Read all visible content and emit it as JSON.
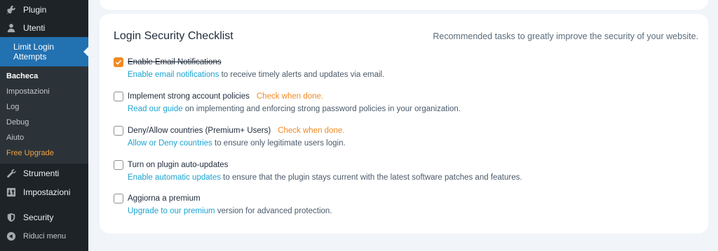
{
  "sidebar": {
    "items_top": [
      {
        "label": "Plugin",
        "icon": "plugin-icon"
      },
      {
        "label": "Utenti",
        "icon": "users-icon"
      }
    ],
    "active": {
      "label": "Limit Login Attempts",
      "icon": "fingerprint-icon"
    },
    "submenu": [
      {
        "label": "Bacheca"
      },
      {
        "label": "Impostazioni"
      },
      {
        "label": "Log"
      },
      {
        "label": "Debug"
      },
      {
        "label": "Aiuto"
      },
      {
        "label": "Free Upgrade"
      }
    ],
    "items_bottom": [
      {
        "label": "Strumenti",
        "icon": "tools-icon"
      },
      {
        "label": "Impostazioni",
        "icon": "settings-icon"
      },
      {
        "label": "Security",
        "icon": "shield-icon"
      },
      {
        "label": "Riduci menu",
        "icon": "collapse-icon"
      }
    ]
  },
  "checklist": {
    "title": "Login Security Checklist",
    "subtitle": "Recommended tasks to greatly improve the security of your website.",
    "tasks": [
      {
        "title": "Enable Email Notifications",
        "done": true,
        "check_note": "",
        "link": "Enable email notifications",
        "desc": " to receive timely alerts and updates via email."
      },
      {
        "title": "Implement strong account policies",
        "done": false,
        "check_note": "Check when done.",
        "link": "Read our guide",
        "desc": " on implementing and enforcing strong password policies in your organization."
      },
      {
        "title": "Deny/Allow countries (Premium+ Users)",
        "done": false,
        "check_note": "Check when done.",
        "link": "Allow or Deny countries",
        "desc": " to ensure only legitimate users login."
      },
      {
        "title": "Turn on plugin auto-updates",
        "done": false,
        "check_note": "",
        "link": "Enable automatic updates",
        "desc": " to ensure that the plugin stays current with the latest software patches and features."
      },
      {
        "title": "Aggiorna a premium",
        "done": false,
        "check_note": "",
        "link": "Upgrade to our premium",
        "desc": " version for advanced protection."
      }
    ]
  },
  "colors": {
    "accent": "#f08a24",
    "link": "#1aa3d0",
    "sidebar_bg": "#1d2327",
    "active_bg": "#2271b1"
  }
}
